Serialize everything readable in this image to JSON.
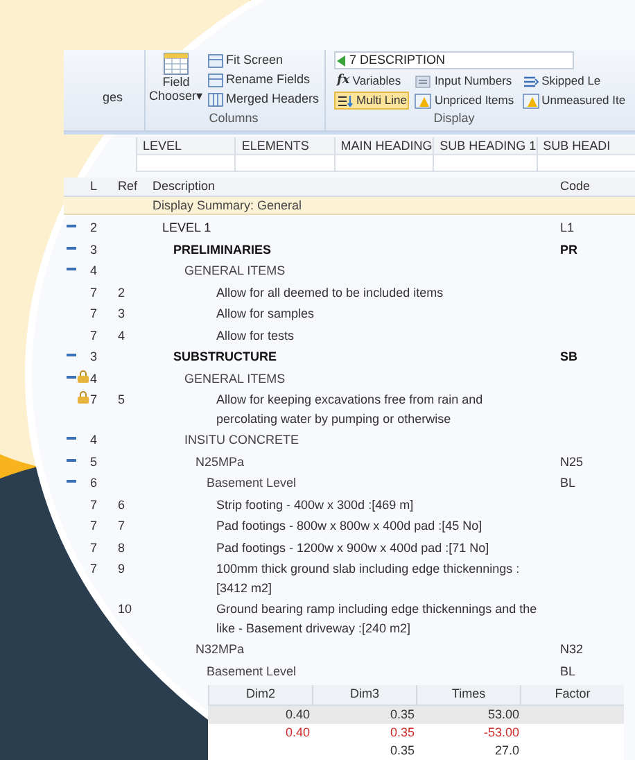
{
  "ribbon": {
    "clipped_group_label": "ges",
    "columns_group": {
      "field_chooser": "Field\nChooser",
      "field_chooser_caret": "▾",
      "items": [
        "Fit Screen",
        "Rename Fields",
        "Merged Headers"
      ],
      "label": "Columns"
    },
    "display_group": {
      "dropdown": "7 DESCRIPTION",
      "variables_icon": "fx",
      "buttons": [
        {
          "label": "Variables",
          "kind": "fx",
          "selected": false
        },
        {
          "label": "Input Numbers",
          "kind": "numbers",
          "selected": false
        },
        {
          "label": "Skipped Le",
          "kind": "skip",
          "selected": false
        },
        {
          "label": "Multi Line",
          "kind": "multiline",
          "selected": true
        },
        {
          "label": "Unpriced Items",
          "kind": "warn",
          "selected": false
        },
        {
          "label": "Unmeasured Ite",
          "kind": "warn",
          "selected": false
        }
      ],
      "label": "Display"
    }
  },
  "level_headers": [
    "LEVEL",
    "ELEMENTS",
    "MAIN HEADING",
    "SUB HEADING 1",
    "SUB HEADI"
  ],
  "grid": {
    "columns": [
      "L",
      "Ref",
      "Description",
      "Code"
    ],
    "summary": "Display Summary: General",
    "rows": [
      {
        "kind": "level",
        "l": "2",
        "description": "LEVEL 1",
        "code": "L1",
        "expanded": true,
        "locked": false,
        "children": [
          {
            "kind": "section",
            "l": "3",
            "description": "PRELIMINARIES",
            "code": "PR",
            "expanded": true,
            "locked": false,
            "children": [
              {
                "kind": "group",
                "l": "4",
                "description": "GENERAL ITEMS",
                "expanded": true,
                "locked": false,
                "children": [
                  {
                    "kind": "item",
                    "l": "7",
                    "ref": "2",
                    "description": "Allow for all deemed to be included items",
                    "locked": false
                  },
                  {
                    "kind": "item",
                    "l": "7",
                    "ref": "3",
                    "description": "Allow for samples",
                    "locked": false
                  },
                  {
                    "kind": "item",
                    "l": "7",
                    "ref": "4",
                    "description": "Allow for tests",
                    "locked": false
                  }
                ]
              }
            ]
          },
          {
            "kind": "section",
            "l": "3",
            "description": "SUBSTRUCTURE",
            "code": "SB",
            "expanded": true,
            "locked": false,
            "children": [
              {
                "kind": "group",
                "l": "4",
                "description": "GENERAL ITEMS",
                "expanded": true,
                "locked": true,
                "children": [
                  {
                    "kind": "item",
                    "l": "7",
                    "ref": "5",
                    "description": "Allow for keeping excavations free from rain and percolating water by pumping or otherwise",
                    "locked": true
                  }
                ]
              },
              {
                "kind": "group",
                "l": "4",
                "description": "INSITU CONCRETE",
                "expanded": true,
                "locked": false,
                "children": [
                  {
                    "kind": "group",
                    "l": "5",
                    "description": "N25MPa",
                    "code": "N25",
                    "expanded": true,
                    "locked": false,
                    "children": [
                      {
                        "kind": "group",
                        "l": "6",
                        "description": "Basement Level",
                        "code": "BL",
                        "expanded": true,
                        "locked": false,
                        "children": [
                          {
                            "kind": "item",
                            "l": "7",
                            "ref": "6",
                            "description": "Strip footing - 400w x 300d :[469 m]",
                            "locked": false
                          },
                          {
                            "kind": "item",
                            "l": "7",
                            "ref": "7",
                            "description": "Pad footings - 800w x 800w x 400d pad :[45 No]",
                            "locked": false
                          },
                          {
                            "kind": "item",
                            "l": "7",
                            "ref": "8",
                            "description": "Pad footings - 1200w x 900w x 400d pad :[71 No]",
                            "locked": false
                          },
                          {
                            "kind": "item",
                            "l": "7",
                            "ref": "9",
                            "description": "100mm thick ground slab including edge thickennings :[3412 m2]",
                            "locked": false
                          },
                          {
                            "kind": "item",
                            "ref": "10",
                            "description": "Ground bearing ramp including edge thickennings and the like - Basement driveway :[240 m2]",
                            "locked": false
                          }
                        ]
                      }
                    ]
                  },
                  {
                    "kind": "group",
                    "description": "N32MPa",
                    "code": "N32",
                    "locked": false,
                    "children": [
                      {
                        "kind": "group",
                        "description": "Basement Level",
                        "code": "BL",
                        "locked": false
                      }
                    ]
                  }
                ]
              }
            ]
          }
        ]
      }
    ]
  },
  "dims": {
    "columns": [
      "Dim2",
      "Dim3",
      "Times",
      "Factor"
    ],
    "rows": [
      {
        "negative": false,
        "selected": true,
        "cells": [
          "0.40",
          "0.35",
          "53.00"
        ]
      },
      {
        "negative": true,
        "selected": false,
        "cells": [
          "0.40",
          "0.35",
          "-53.00"
        ]
      },
      {
        "negative": false,
        "selected": false,
        "cells": [
          "",
          "0.35",
          "27.0"
        ]
      }
    ]
  }
}
